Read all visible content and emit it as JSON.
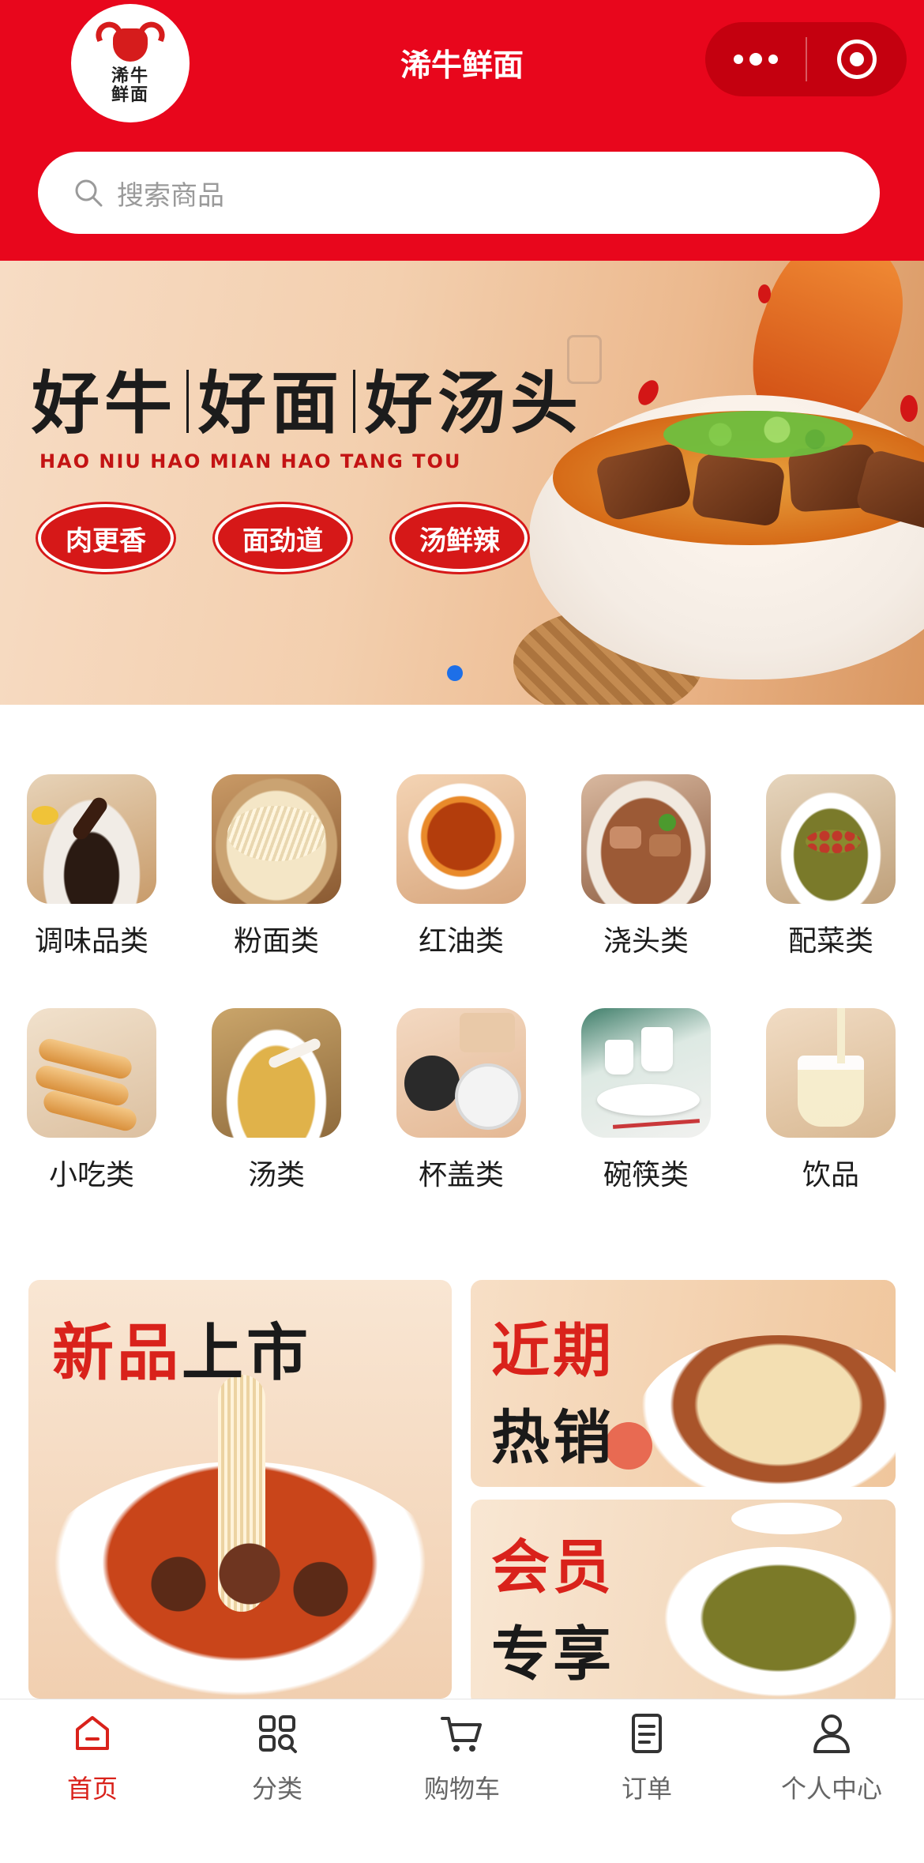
{
  "app": {
    "title": "浠牛鲜面",
    "logo_text": "浠牛鲜面"
  },
  "search": {
    "placeholder": "搜索商品"
  },
  "banner": {
    "headline": [
      "好牛",
      "好面",
      "好汤头"
    ],
    "pinyin": "HAO NIU HAO MIAN HAO TANG TOU",
    "badges": [
      "肉更香",
      "面劲道",
      "汤鲜辣"
    ],
    "active_slide": 1,
    "slide_count": 1
  },
  "categories": [
    {
      "label": "调味品类",
      "icon": "sauce-bowl-icon"
    },
    {
      "label": "粉面类",
      "icon": "noodles-icon"
    },
    {
      "label": "红油类",
      "icon": "chili-oil-icon"
    },
    {
      "label": "浇头类",
      "icon": "beef-topping-icon"
    },
    {
      "label": "配菜类",
      "icon": "side-dish-icon"
    },
    {
      "label": "小吃类",
      "icon": "snack-icon"
    },
    {
      "label": "汤类",
      "icon": "soup-icon"
    },
    {
      "label": "杯盖类",
      "icon": "cup-lid-icon"
    },
    {
      "label": "碗筷类",
      "icon": "bowl-chopsticks-icon"
    },
    {
      "label": "饮品",
      "icon": "drink-icon"
    }
  ],
  "promos": {
    "new": {
      "line1_red": "新品",
      "line1_dark": "上市"
    },
    "hot": {
      "line1": "近期",
      "line2": "热销"
    },
    "member": {
      "line1": "会员",
      "line2": "专享"
    }
  },
  "tabbar": {
    "active": "home",
    "items": [
      {
        "label": "首页",
        "icon": "home-icon"
      },
      {
        "label": "分类",
        "icon": "category-icon"
      },
      {
        "label": "购物车",
        "icon": "cart-icon"
      },
      {
        "label": "订单",
        "icon": "order-icon"
      },
      {
        "label": "个人中心",
        "icon": "user-icon"
      }
    ]
  },
  "colors": {
    "brand_red": "#e8061c",
    "capsule_red": "#c4000f",
    "accent_red": "#d9221b",
    "indicator_blue": "#1d6fe8"
  }
}
